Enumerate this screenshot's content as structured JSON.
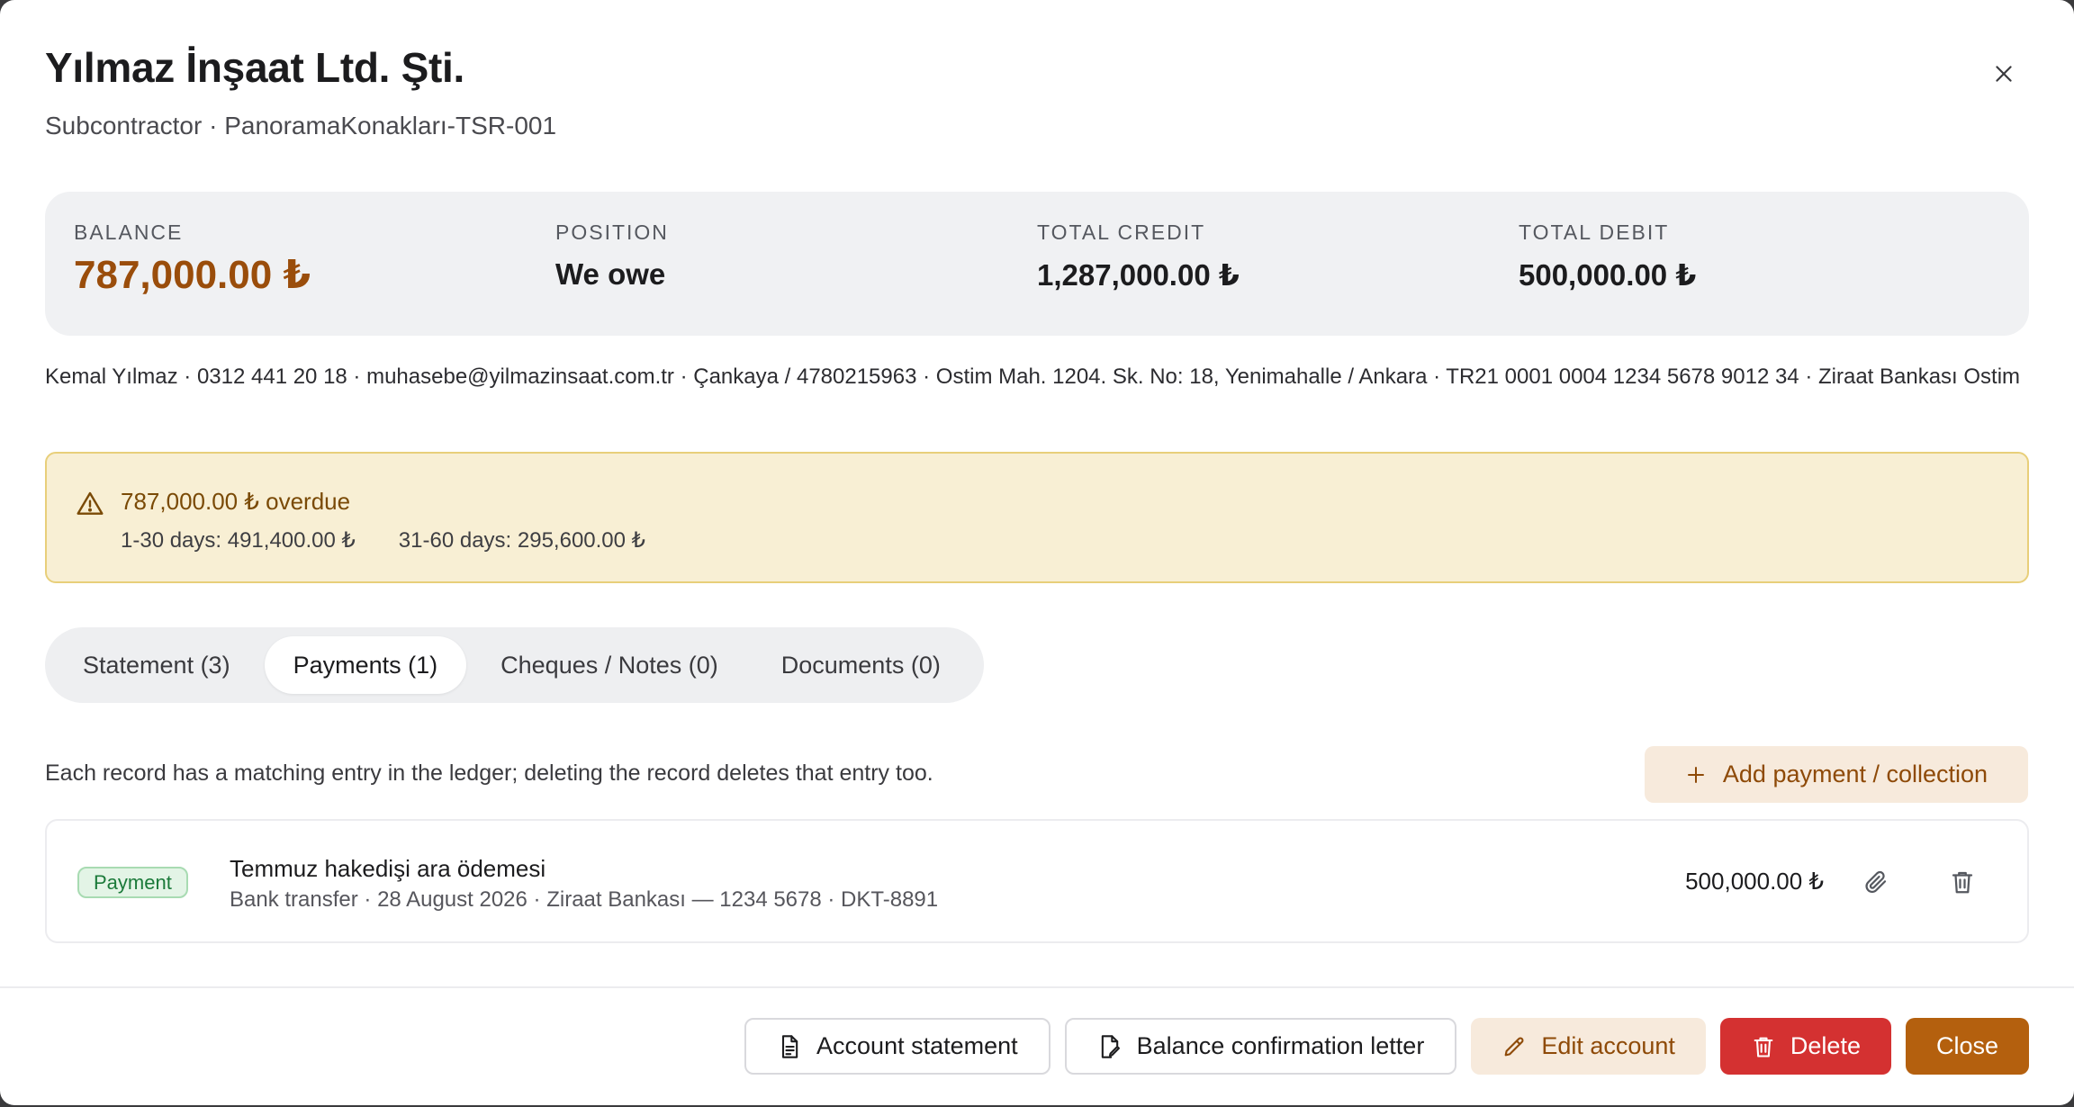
{
  "header": {
    "title": "Yılmaz İnşaat Ltd. Şti.",
    "subtitle": "Subcontractor · PanoramaKonakları-TSR-001"
  },
  "summary": {
    "balance_label": "BALANCE",
    "balance_value": "787,000.00 ₺",
    "position_label": "POSITION",
    "position_value": "We owe",
    "credit_label": "TOTAL CREDIT",
    "credit_value": "1,287,000.00 ₺",
    "debit_label": "TOTAL DEBIT",
    "debit_value": "500,000.00 ₺"
  },
  "contact_line": "Kemal Yılmaz · 0312 441 20 18 · muhasebe@yilmazinsaat.com.tr · Çankaya / 4780215963 · Ostim Mah. 1204. Sk. No: 18, Yenimahalle / Ankara · TR21 0001 0004 1234 5678 9012 34 · Ziraat Bankası Ostim",
  "alert": {
    "title": "787,000.00 ₺ overdue",
    "bucket_1": "1-30 days: 491,400.00 ₺",
    "bucket_2": "31-60 days: 295,600.00 ₺",
    "icon": "warning-triangle-icon"
  },
  "tabs": [
    {
      "label": "Statement (3)",
      "active": false
    },
    {
      "label": "Payments (1)",
      "active": true
    },
    {
      "label": "Cheques / Notes (0)",
      "active": false
    },
    {
      "label": "Documents (0)",
      "active": false
    }
  ],
  "payments": {
    "info": "Each record has a matching entry in the ledger; deleting the record deletes that entry too.",
    "add_label": "Add payment / collection",
    "records": [
      {
        "badge": "Payment",
        "title": "Temmuz hakedişi ara ödemesi",
        "meta": "Bank transfer · 28 August 2026 · Ziraat Bankası — 1234 5678 · DKT-8891",
        "amount": "500,000.00 ₺"
      }
    ]
  },
  "footer": {
    "statement_label": "Account statement",
    "confirmation_label": "Balance confirmation letter",
    "edit_label": "Edit account",
    "delete_label": "Delete",
    "close_label": "Close"
  },
  "colors": {
    "accent": "#b4600e",
    "balance": "#9a4d0b",
    "danger": "#d43131",
    "warning_bg": "#f8efd4",
    "success": "#1b7a3a"
  }
}
